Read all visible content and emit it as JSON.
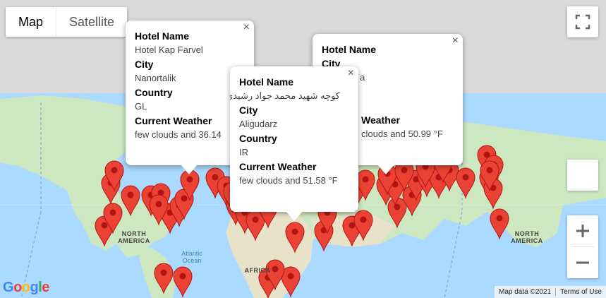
{
  "map_type": {
    "map_label": "Map",
    "satellite_label": "Satellite"
  },
  "labels": {
    "north_america": "NORTH AMERICA",
    "north_america_east": "NORTH AMERICA",
    "africa": "AFRICA",
    "atlantic_ocean": "Atlantic Ocean"
  },
  "footer": {
    "logo": "Google",
    "map_data": "Map data ©2021",
    "terms": "Terms of Use"
  },
  "marker_color": "#ea4335",
  "infowindows": [
    {
      "hotel_name_label": "Hotel Name",
      "hotel_name": "Hotel Kap Farvel",
      "city_label": "City",
      "city": "Nanortalik",
      "country_label": "Country",
      "country": "GL",
      "weather_label": "Current Weather",
      "weather": "few clouds and 36.14"
    },
    {
      "hotel_name_label": "Hotel Name",
      "hotel_name": "",
      "city_label": "City",
      "city": "",
      "country_label": "",
      "country": "",
      "weather_label": "Weather",
      "weather": "clouds and 50.99 °F"
    },
    {
      "hotel_name_label": "Hotel Name",
      "hotel_name": "کوچه شهید محمد جواد رشیدی",
      "city_label": "City",
      "city": "Aligudarz",
      "country_label": "Country",
      "country": "IR",
      "weather_label": "Current Weather",
      "weather": "few clouds and 51.58 °F"
    }
  ],
  "partial_text": {
    "city_suffix": "a"
  }
}
